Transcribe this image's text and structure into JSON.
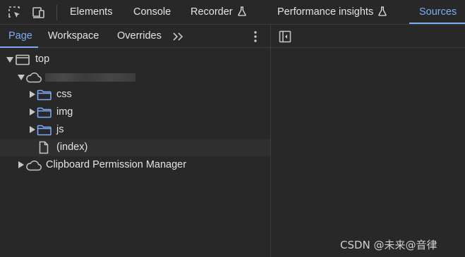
{
  "toolbar": {
    "icons": [
      "select-element-icon",
      "device-toolbar-icon"
    ],
    "tabs": [
      {
        "label": "Elements"
      },
      {
        "label": "Console"
      },
      {
        "label": "Recorder",
        "icon": "flask-icon"
      },
      {
        "label": "Performance insights",
        "icon": "flask-icon"
      },
      {
        "label": "Sources",
        "active": true
      }
    ]
  },
  "navigator": {
    "tabs": [
      {
        "label": "Page",
        "active": true
      },
      {
        "label": "Workspace"
      },
      {
        "label": "Overrides"
      }
    ],
    "more_tabs_icon": "chevron-double-right-icon",
    "menu_icon": "kebab-menu-icon",
    "tree": {
      "frame": {
        "label": "top",
        "icon": "frame-icon",
        "expanded": true
      },
      "origin": {
        "label": "",
        "icon": "cloud-icon",
        "expanded": true,
        "label_obscured": true
      },
      "folders": [
        {
          "label": "css",
          "icon": "folder-icon",
          "expanded": false
        },
        {
          "label": "img",
          "icon": "folder-icon",
          "expanded": false
        },
        {
          "label": "js",
          "icon": "folder-icon",
          "expanded": false
        }
      ],
      "file": {
        "label": "(index)",
        "icon": "file-icon",
        "selected": true
      },
      "extension": {
        "label": "Clipboard Permission Manager",
        "icon": "cloud-icon",
        "expanded": false
      }
    }
  },
  "editor": {
    "toggle_icon": "show-navigator-icon"
  },
  "watermark": "CSDN @未来@音律",
  "colors": {
    "accent": "#7cacf8",
    "background": "#282828",
    "text": "#e3e3e3",
    "selected_row": "#2f2f2f"
  }
}
